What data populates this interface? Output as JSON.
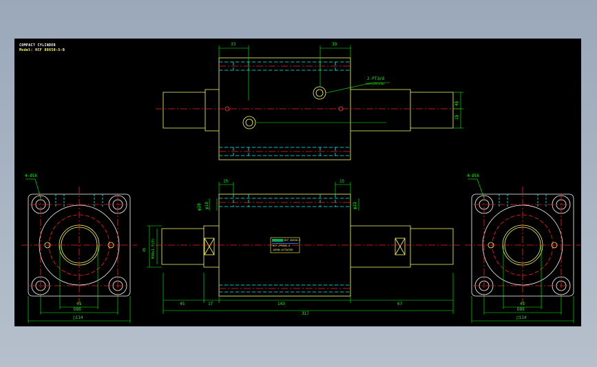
{
  "title": {
    "line1": "COMPACT CYLINDER",
    "line2": "Model: HCF 80X50-S-B"
  },
  "top_view": {
    "dim_left": "33",
    "dim_right": "33",
    "port_note": "2-PT3/8",
    "port_sub": "PORT(DPH)RING",
    "dim_r1": "45",
    "dim_r2": "15"
  },
  "front_view": {
    "dim_top_left": "15",
    "dim_top_right": "15",
    "dim_v_left_a": "φ20",
    "dim_v_left_b": "φ18",
    "dim_v_right": "φ23",
    "dim_h_left": "M30x1.5(P)",
    "dim_h_left2": "45",
    "dim_45": "45",
    "dim_17": "17",
    "dim_143": "143",
    "dim_67": "67",
    "dim_317": "317",
    "nameplate1": "HCF 80X50-S",
    "nameplate2": "HCF-JPXXXX-X",
    "nameplate3": "JAPAN-ACTUATOR"
  },
  "left_flange": {
    "holes_label": "4-Ø16",
    "dim_41": "41",
    "dim_d86": "D86",
    "dim_114": "□114"
  },
  "right_flange": {
    "holes_label": "4-Ø16",
    "dim_41": "41",
    "dim_d86": "D86",
    "dim_114": "□114"
  }
}
